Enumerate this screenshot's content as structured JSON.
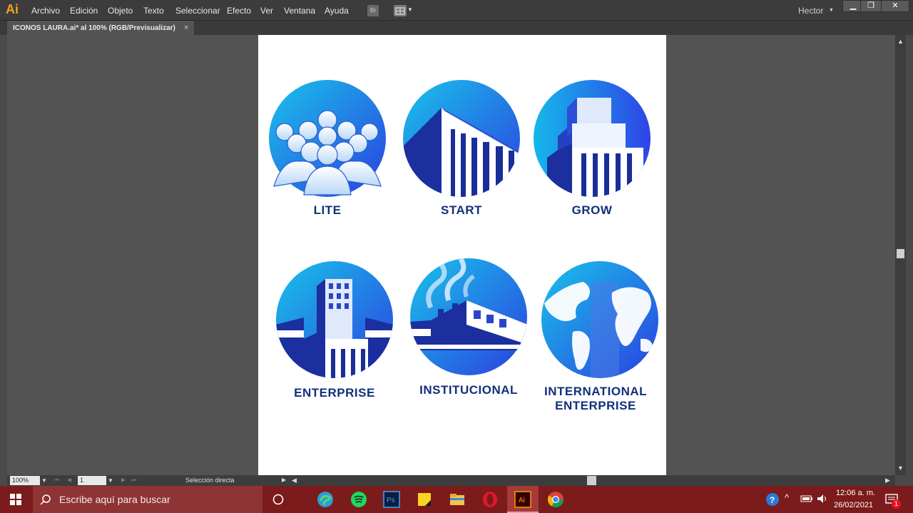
{
  "app": {
    "logo": "Ai",
    "user": "Hector"
  },
  "menu": [
    "Archivo",
    "Edición",
    "Objeto",
    "Texto",
    "Seleccionar",
    "Efecto",
    "Ver",
    "Ventana",
    "Ayuda"
  ],
  "toolbar": {
    "bridge_label": "Br"
  },
  "document": {
    "tab_title": "ICONOS LAURA.ai* al 100% (RGB/Previsualizar)"
  },
  "icons": [
    {
      "label": "LITE"
    },
    {
      "label": "START"
    },
    {
      "label": "GROW"
    },
    {
      "label": "ENTERPRISE"
    },
    {
      "label": "INSTITUCIONAL"
    },
    {
      "label_line1": "INTERNATIONAL",
      "label_line2": "ENTERPRISE"
    }
  ],
  "status": {
    "zoom": "100%",
    "page": "1",
    "tool": "Selección directa"
  },
  "taskbar": {
    "search_placeholder": "Escribe aquí para buscar",
    "time": "12:06 a. m.",
    "date": "26/02/2021",
    "notification_count": "1"
  },
  "colors": {
    "accent": "#12307a",
    "icon_light": "#19c3ea",
    "icon_dark": "#2b3fe0",
    "taskbar": "#7c1b1b"
  }
}
